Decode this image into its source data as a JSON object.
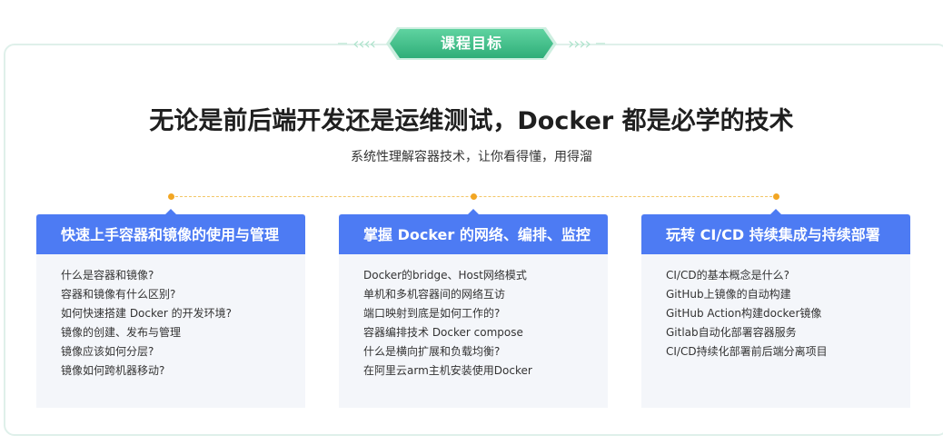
{
  "header": {
    "badge_label": "课程目标",
    "left_chevrons": "‹‹‹‹",
    "right_chevrons": "››››"
  },
  "title": "无论是前后端开发还是运维测试，Docker 都是必学的技术",
  "subtitle": "系统性理解容器技术，让你看得懂，用得溜",
  "colors": {
    "badge_green": "#3fbf8a",
    "card_header_blue": "#4d7bf3",
    "timeline_dot": "#f2a623",
    "card_bg": "#f4f6fa"
  },
  "cards": [
    {
      "title": "快速上手容器和镜像的使用与管理",
      "items": [
        "什么是容器和镜像?",
        "容器和镜像有什么区别?",
        "如何快速搭建 Docker 的开发环境?",
        "镜像的创建、发布与管理",
        "镜像应该如何分层?",
        "镜像如何跨机器移动?"
      ]
    },
    {
      "title": "掌握 Docker 的网络、编排、监控",
      "items": [
        "Docker的bridge、Host网络模式",
        "单机和多机容器间的网络互访",
        "端口映射到底是如何工作的?",
        "容器编排技术 Docker compose",
        "什么是横向扩展和负载均衡?",
        "在阿里云arm主机安装使用Docker"
      ]
    },
    {
      "title": "玩转 CI/CD 持续集成与持续部署",
      "items": [
        "CI/CD的基本概念是什么?",
        "GitHub上镜像的自动构建",
        "GitHub Action构建docker镜像",
        "Gitlab自动化部署容器服务",
        "CI/CD持续化部署前后端分离项目"
      ]
    }
  ]
}
